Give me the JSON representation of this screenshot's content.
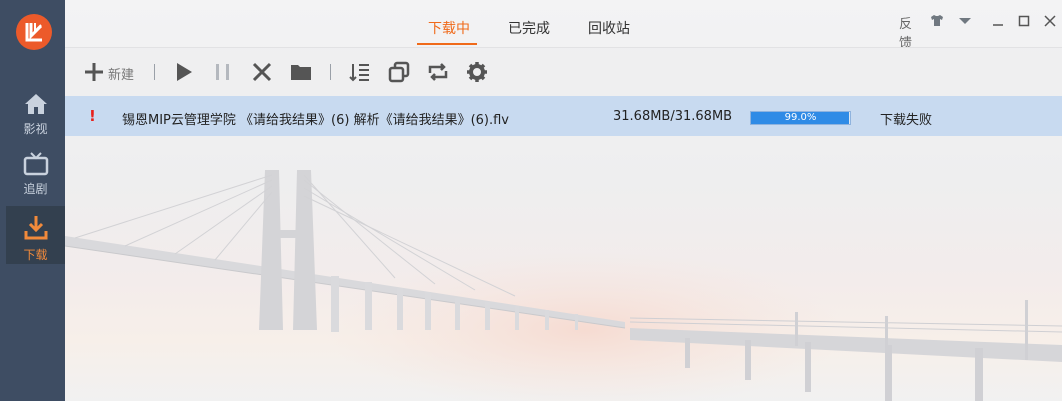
{
  "sidebar": {
    "items": [
      {
        "label": "影视",
        "icon": "home-icon"
      },
      {
        "label": "追剧",
        "icon": "tv-icon"
      },
      {
        "label": "下载",
        "icon": "download-icon"
      }
    ]
  },
  "tabs": [
    {
      "label": "下载中"
    },
    {
      "label": "已完成"
    },
    {
      "label": "回收站"
    }
  ],
  "window": {
    "feedback": "反馈"
  },
  "toolbar": {
    "new_label": "新建"
  },
  "download": {
    "name": "锡恩MIP云管理学院 《请给我结果》(6) 解析《请给我结果》(6).flv",
    "size": "31.68MB/31.68MB",
    "progress_text": "99.0%",
    "progress": 0.99,
    "status": "下载失败"
  },
  "colors": {
    "accent": "#f06a1a",
    "selected_row": "#c8daf0",
    "progress": "#2f8be6"
  }
}
